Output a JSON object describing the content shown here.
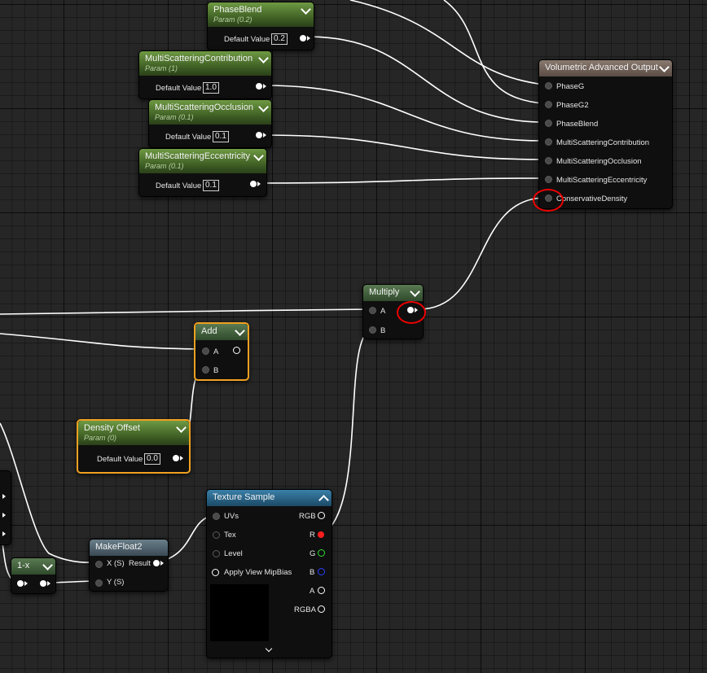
{
  "nodes": {
    "phase_blend": {
      "title": "PhaseBlend",
      "sub": "Param (0.2)",
      "label": "Default Value",
      "value": "0.2"
    },
    "msc": {
      "title": "MultiScatteringContribution",
      "sub": "Param (1)",
      "label": "Default Value",
      "value": "1.0"
    },
    "mso": {
      "title": "MultiScatteringOcclusion",
      "sub": "Param (0.1)",
      "label": "Default Value",
      "value": "0.1"
    },
    "mse": {
      "title": "MultiScatteringEccentricity",
      "sub": "Param (0.1)",
      "label": "Default Value",
      "value": "0.1"
    },
    "output": {
      "title": "Volumetric Advanced Output",
      "pins": [
        "PhaseG",
        "PhaseG2",
        "PhaseBlend",
        "MultiScatteringContribution",
        "MultiScatteringOcclusion",
        "MultiScatteringEccentricity",
        "ConservativeDensity"
      ]
    },
    "multiply": {
      "title": "Multiply",
      "a": "A",
      "b": "B"
    },
    "add": {
      "title": "Add",
      "a": "A",
      "b": "B"
    },
    "density_offset": {
      "title": "Density Offset",
      "sub": "Param (0)",
      "label": "Default Value",
      "value": "0.0"
    },
    "texture_sample": {
      "title": "Texture Sample",
      "inputs": [
        "UVs",
        "Tex",
        "Level",
        "Apply View MipBias"
      ],
      "outputs": [
        "RGB",
        "R",
        "G",
        "B",
        "A",
        "RGBA"
      ]
    },
    "makefloat2": {
      "title": "MakeFloat2",
      "x": "X (S)",
      "y": "Y (S)",
      "result": "Result"
    },
    "one_minus_x": {
      "title": "1-x"
    }
  },
  "colors": {
    "accent_selected": "#f0a020",
    "param_header": "#5d8a3a",
    "annotation": "#e00000",
    "r_pin": "#ff1e1e",
    "g_pin": "#2fdc2f",
    "b_pin": "#2840ff"
  },
  "annotations": [
    "red-circle-conservative-density-pin",
    "red-circle-multiply-output-pin"
  ]
}
